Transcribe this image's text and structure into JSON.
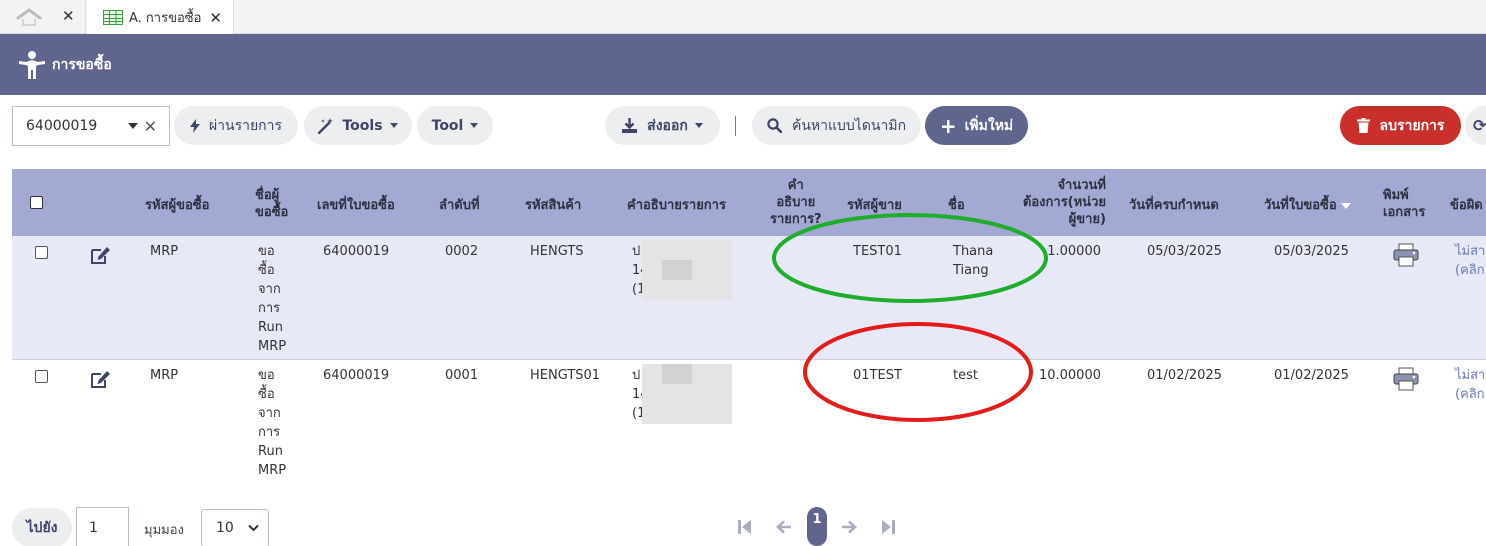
{
  "tabs": [
    {
      "icon": "home-icon"
    },
    {
      "icon": "spreadsheet-icon",
      "label": "A. การขอซื้อ"
    }
  ],
  "header": {
    "title": "การขอซื้อ",
    "icon": "purchase-person-icon"
  },
  "toolbar": {
    "search_value": "64000019",
    "approve_label": "ผ่านรายการ",
    "tools_label": "Tools",
    "tool_label": "Tool",
    "export_label": "ส่งออก",
    "dynamic_search_label": "ค้นหาแบบไดนามิก",
    "add_label": "เพิ่มใหม่",
    "delete_label": "ลบรายการ"
  },
  "table": {
    "headers": {
      "buyer_code": "รหัสผู้ขอซื้อ",
      "buyer_name": [
        "ชื่อผู้",
        "ขอซื้อ"
      ],
      "pr_no": "เลขที่ใบขอซื้อ",
      "seq": "ลำดับที่",
      "product_code": "รหัสสินค้า",
      "desc": "คำอธิบายรายการ",
      "desc_q": [
        "คำ",
        "อธิบาย",
        "รายการ?"
      ],
      "vendor_code": "รหัสผู้ขาย",
      "name": "ชื่อ",
      "qty": [
        "จำนวนที่",
        "ต้องการ(หน่วย",
        "ผู้ขาย)"
      ],
      "due_date": "วันที่ครบกำหนด",
      "pr_date": "วันที่ใบขอซื้อ",
      "print": [
        "พิมพ์",
        "เอกสาร"
      ],
      "error": "ข้อผิด"
    },
    "rows": [
      {
        "buyer_code": "MRP",
        "buyer_name": [
          "ขอ",
          "ซื้อ",
          "จาก",
          "การ",
          "Run",
          "MRP"
        ],
        "pr_no": "64000019",
        "seq": "0002",
        "product_code": "HENGTS",
        "desc": [
          "ป",
          "14",
          "(1"
        ],
        "vendor_code": "TEST01",
        "name": [
          "Thana",
          "Tiang"
        ],
        "qty": "1.00000",
        "due_date": "05/03/2025",
        "pr_date": "05/03/2025",
        "error": [
          "ไม่สา",
          "(คลิก"
        ]
      },
      {
        "buyer_code": "MRP",
        "buyer_name": [
          "ขอ",
          "ซื้อ",
          "จาก",
          "การ",
          "Run",
          "MRP"
        ],
        "pr_no": "64000019",
        "seq": "0001",
        "product_code": "HENGTS01",
        "desc": [
          "ป",
          "14",
          "(1"
        ],
        "vendor_code": "01TEST",
        "name": [
          "test"
        ],
        "qty": "10.00000",
        "due_date": "01/02/2025",
        "pr_date": "01/02/2025",
        "error": [
          "ไม่สา",
          "(คลิก"
        ]
      }
    ]
  },
  "pager": {
    "goto_label": "ไปยัง",
    "page_input": "1",
    "view_label": "มุมมอง",
    "page_size": "10",
    "current_page": "1"
  },
  "colors": {
    "header_bg": "#5f658d",
    "table_header_bg": "#a3a9d3",
    "selected_row_bg": "#e8e9f6",
    "delete_btn": "#c9302c",
    "add_btn": "#5f658d",
    "green_circle": "#1fae2b",
    "red_circle": "#e31b1b"
  }
}
